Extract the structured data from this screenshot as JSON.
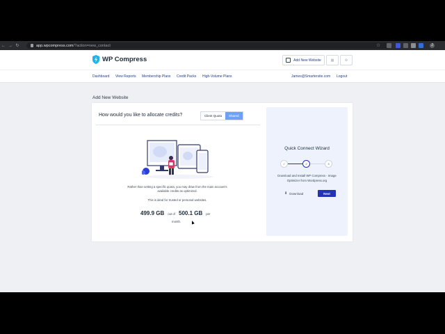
{
  "browser": {
    "url_host": "app.wpcompress.com",
    "url_path": "/?action=new_contact",
    "profile_initial": "J"
  },
  "header": {
    "brand": "WP Compress",
    "add_site_label": "Add New Website"
  },
  "nav": {
    "items": [
      "Dashboard",
      "View Reports",
      "Membership Plans",
      "Credit Packs",
      "High-Volume Plans"
    ],
    "email": "James@Smartersite.com",
    "logout": "Logout"
  },
  "page": {
    "title": "Add New Website",
    "question": "How would you like to allocate credits?",
    "toggle": {
      "option1": "Client Quota",
      "option2": "Shared"
    },
    "desc1": "Rather than setting a specific quota, you may draw from the main account's available credits as optimized.",
    "desc2": "This is ideal for trusted or personal websites.",
    "quota_used": "499.9 GB",
    "out_of": "out of",
    "quota_total": "500.1 GB",
    "per": "per",
    "month": "month."
  },
  "wizard": {
    "title": "Quick Connect Wizard",
    "steps": [
      "✓",
      "2",
      "3"
    ],
    "instruction": "Download and Install WP Compress - Image Optimizer from Wordpress.org",
    "download": "Download",
    "next": "Next"
  },
  "colors": {
    "accent": "#6ea0f4",
    "primary": "#2233b8",
    "link": "#23418a",
    "brand_icon": "#22b3e6"
  }
}
